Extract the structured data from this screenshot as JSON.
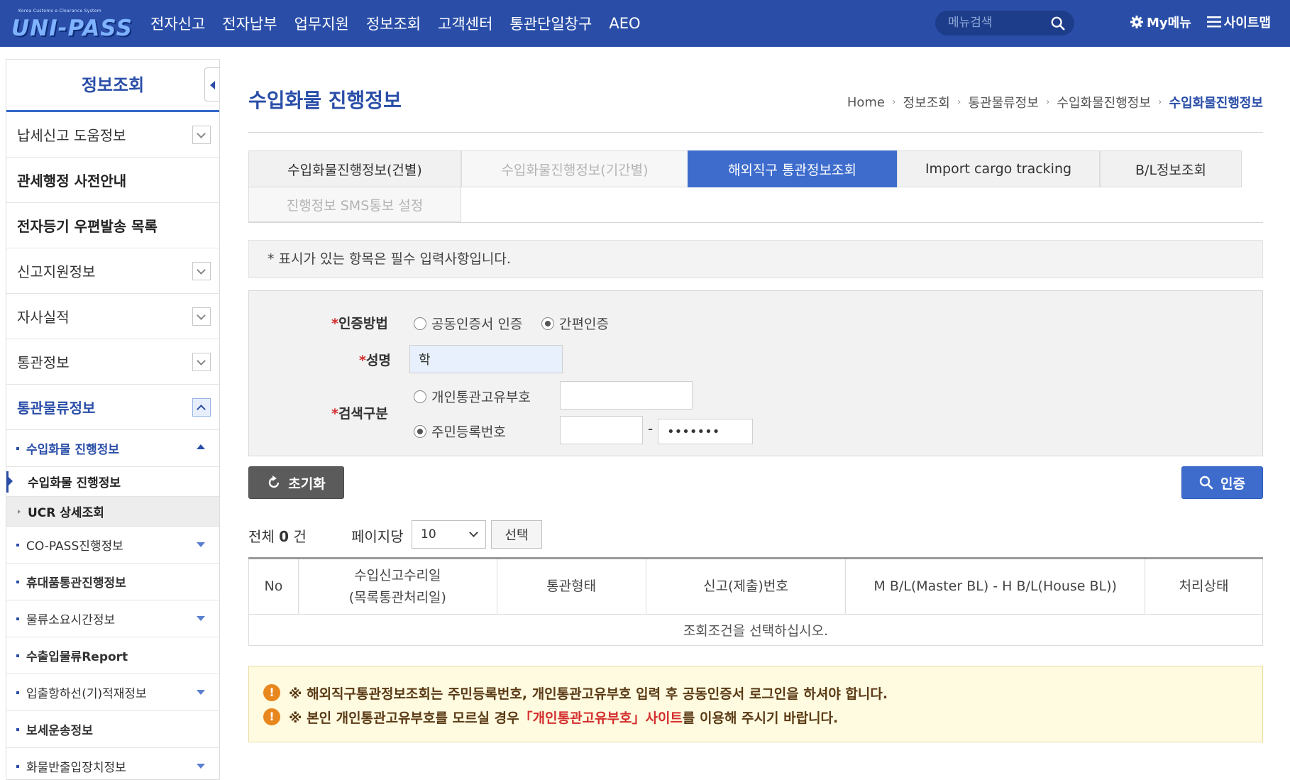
{
  "header": {
    "logo_sub": "Korea Customs e-Clearance System",
    "logo_text": "UNI-PASS",
    "nav": [
      "전자신고",
      "전자납부",
      "업무지원",
      "정보조회",
      "고객센터",
      "통관단일창구",
      "AEO"
    ],
    "search_placeholder": "메뉴검색",
    "my_menu": "My메뉴",
    "sitemap": "사이트맵"
  },
  "sidebar": {
    "title": "정보조회",
    "items": [
      {
        "label": "납세신고 도움정보"
      },
      {
        "label": "관세행정 사전안내"
      },
      {
        "label": "전자등기 우편발송 목록"
      },
      {
        "label": "신고지원정보"
      },
      {
        "label": "자사실적"
      },
      {
        "label": "통관정보"
      },
      {
        "label": "통관물류정보"
      }
    ],
    "subitems": [
      {
        "label": "수입화물 진행정보"
      },
      {
        "label": "수입화물 진행정보"
      },
      {
        "label": "UCR 상세조회"
      },
      {
        "label": "CO-PASS진행정보"
      },
      {
        "label": "휴대품통관진행정보"
      },
      {
        "label": "물류소요시간정보"
      },
      {
        "label": "수출입물류Report"
      },
      {
        "label": "입출항하선(기)적재정보"
      },
      {
        "label": "보세운송정보"
      },
      {
        "label": "화물반출입장치정보"
      }
    ]
  },
  "page": {
    "title": "수입화물 진행정보",
    "breadcrumb": [
      "Home",
      "정보조회",
      "통관물류정보",
      "수입화물진행정보",
      "수입화물진행정보"
    ]
  },
  "tabs": [
    {
      "label": "수입화물진행정보(건별)"
    },
    {
      "label": "수입화물진행정보(기간별)"
    },
    {
      "label": "해외직구 통관정보조회"
    },
    {
      "label": "Import cargo tracking"
    },
    {
      "label": "B/L정보조회"
    },
    {
      "label": "진행정보 SMS통보 설정"
    }
  ],
  "notice": "* 표시가 있는 항목은 필수 입력사항입니다.",
  "form": {
    "req_mark": "*",
    "auth_label": "인증방법",
    "auth_options": [
      "공동인증서 인증",
      "간편인증"
    ],
    "auth_selected": "간편인증",
    "name_label": "성명",
    "name_value": "학",
    "search_label": "검색구분",
    "search_options": [
      "개인통관고유부호",
      "주민등록번호"
    ],
    "search_selected": "주민등록번호",
    "personal_code_value": "",
    "rrn_front_value": "",
    "rrn_dash": "-",
    "rrn_back_value": "•••••••"
  },
  "buttons": {
    "reset": "초기화",
    "auth": "인증",
    "select": "선택"
  },
  "results": {
    "total_prefix": "전체",
    "total_count": "0",
    "total_suffix": "건",
    "per_page_label": "페이지당",
    "per_page_value": "10"
  },
  "table": {
    "headers": [
      {
        "line1": "No",
        "line2": ""
      },
      {
        "line1": "수입신고수리일",
        "line2": "(목록통관처리일)"
      },
      {
        "line1": "통관형태",
        "line2": ""
      },
      {
        "line1": "신고(제출)번호",
        "line2": ""
      },
      {
        "line1": "M B/L(Master BL) - H B/L(House BL))",
        "line2": ""
      },
      {
        "line1": "처리상태",
        "line2": ""
      }
    ],
    "empty_message": "조회조건을 선택하십시오."
  },
  "warnings": {
    "line1": "※ 해외직구통관정보조회는 주민등록번호, 개인통관고유부호 입력 후 공동인증서 로그인을 하셔야 합니다.",
    "line2_pre": "※ 본인 개인통관고유부호를 모르실 경우 ",
    "line2_link": "「개인통관고유부호」사이트",
    "line2_post": "를 이용해 주시기 바랍니다.",
    "icon": "!"
  },
  "colors": {
    "brand": "#2a4ea8",
    "active_tab": "#3d6ccd",
    "required": "#d32d2d",
    "warning_bg": "#fffbe0",
    "warning_icon": "#e8871e"
  }
}
